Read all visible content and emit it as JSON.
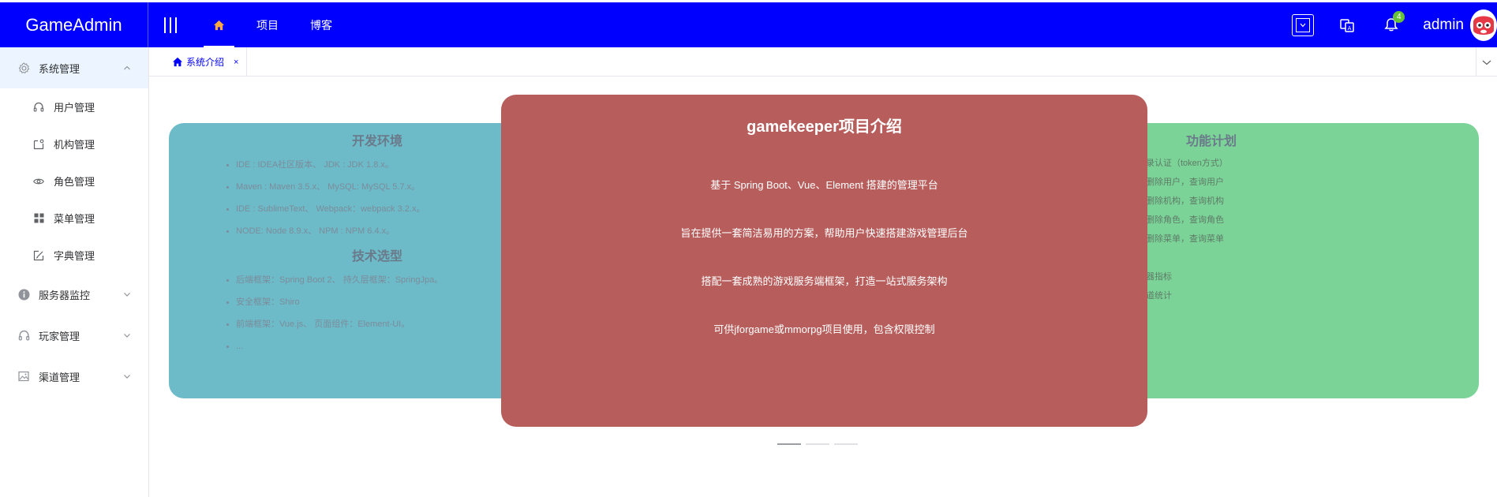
{
  "header": {
    "logo": "GameAdmin",
    "nav": [
      {
        "label": "",
        "icon": "home-icon",
        "active": true
      },
      {
        "label": "项目",
        "active": false
      },
      {
        "label": "博客",
        "active": false
      }
    ],
    "notification_count": "4",
    "username": "admin",
    "accent_color": "#0000ff"
  },
  "sidebar": {
    "groups": [
      {
        "label": "系统管理",
        "icon": "gear-icon",
        "open": true,
        "items": [
          {
            "label": "用户管理",
            "icon": "headset-icon"
          },
          {
            "label": "机构管理",
            "icon": "folder-icon"
          },
          {
            "label": "角色管理",
            "icon": "eye-icon"
          },
          {
            "label": "菜单管理",
            "icon": "grid-icon"
          },
          {
            "label": "字典管理",
            "icon": "edit-icon"
          }
        ]
      },
      {
        "label": "服务器监控",
        "icon": "info-icon",
        "open": false
      },
      {
        "label": "玩家管理",
        "icon": "headset-icon",
        "open": false
      },
      {
        "label": "渠道管理",
        "icon": "picture-icon",
        "open": false
      }
    ]
  },
  "tabs": [
    {
      "label": "系统介绍",
      "close": "×",
      "icon": "home-icon"
    }
  ],
  "carousel": {
    "left": {
      "title1": "开发环境",
      "items1": [
        "IDE : IDEA社区版本、 JDK : JDK 1.8.x。",
        "Maven : Maven 3.5.x、 MySQL: MySQL 5.7.x。",
        "IDE : SublimeText、 Webpack：webpack 3.2.x。",
        "NODE: Node 8.9.x、 NPM : NPM 6.4.x。"
      ],
      "title2": "技术选型",
      "items2": [
        "后端框架：Spring Boot 2、 持久层框架：SpringJpa。",
        "安全框架：Shiro",
        "前端框架：Vue.js、 页面组件：Element-UI。",
        "..."
      ],
      "color": "#6dbbc8"
    },
    "center": {
      "title": "gamekeeper项目介绍",
      "lines": [
        "基于 Spring Boot、Vue、Element 搭建的管理平台",
        "旨在提供一套简洁易用的方案，帮助用户快速搭建游戏管理后台",
        "搭配一套成熟的游戏服务端框架，打造一站式服务架构",
        "可供jforgame或mmorpg项目使用，包含权限控制"
      ],
      "color": "#b75e5d"
    },
    "right": {
      "title": "功能计划",
      "items": [
        "录认证（token方式）",
        "删除用户，查询用户",
        "删除机构，查询机构",
        "删除角色，查询角色",
        "删除菜单，查询菜单",
        "",
        "器指标",
        "道统计"
      ],
      "color": "#7bd398"
    },
    "indicator_count": 3,
    "active_index": 0
  }
}
